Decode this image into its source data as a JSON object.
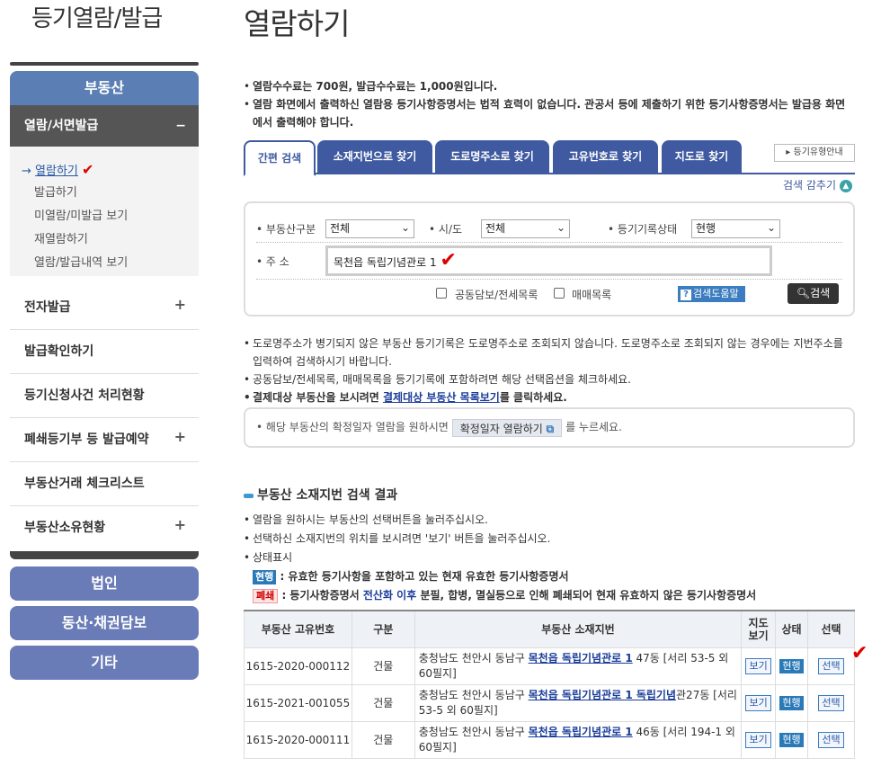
{
  "sidebar": {
    "title": "등기열람/발급",
    "category_main": "부동산",
    "open_section": {
      "label": "열람/서면발급",
      "toggle": "−"
    },
    "sub_items": [
      {
        "label": "열람하기",
        "active": true,
        "marker": "→",
        "check": "✔"
      },
      {
        "label": "발급하기"
      },
      {
        "label": "미열람/미발급 보기"
      },
      {
        "label": "재열람하기"
      },
      {
        "label": "열람/발급내역 보기"
      }
    ],
    "menu_items": [
      {
        "label": "전자발급",
        "toggle": "+"
      },
      {
        "label": "발급확인하기",
        "toggle": ""
      },
      {
        "label": "등기신청사건 처리현황",
        "toggle": ""
      },
      {
        "label": "폐쇄등기부 등 발급예약",
        "toggle": "+"
      },
      {
        "label": "부동산거래 체크리스트",
        "toggle": ""
      },
      {
        "label": "부동산소유현황",
        "toggle": "+"
      }
    ],
    "categories": [
      "법인",
      "동산·채권담보",
      "기타"
    ]
  },
  "main": {
    "title": "열람하기",
    "notice": [
      "열람수수료는 700원, 발급수수료는 1,000원입니다.",
      "열람 화면에서 출력하신 열람용 등기사항증명서는 법적 효력이 없습니다. 관공서 등에 제출하기 위한 등기사항증명서는 발급용 화면에서 출력해야 합니다."
    ],
    "tabs": [
      "간편 검색",
      "소재지번으로 찾기",
      "도로명주소로 찾기",
      "고유번호로 찾기",
      "지도로 찾기"
    ],
    "type_guide_label": "▸ 등기유형안내",
    "collapse_label": "검색 감추기",
    "search": {
      "property_type_label": "부동산구분",
      "property_type_value": "전체",
      "region_label": "시/도",
      "region_value": "전체",
      "record_status_label": "등기기록상태",
      "record_status_value": "현행",
      "address_label": "주 소",
      "address_value": "목천읍 독립기념관로 1",
      "option_joint": "공동담보/전세목록",
      "option_sale": "매매목록",
      "help_label": "검색도움말",
      "search_label": "검색"
    },
    "info": [
      "도로명주소가 병기되지 않은 부동산 등기기록은 도로명주소로 조회되지 않습니다. 도로명주소로 조회되지 않는 경우에는 지번주소를 입력하여 검색하시기 바랍니다.",
      "공동담보/전세목록, 매매목록을 등기기록에 포함하려면 해당 선택옵션을 체크하세요."
    ],
    "info_payment_prefix": "결제대상 부동산을 보시려면 ",
    "info_payment_link": "결제대상 부동산 목록보기",
    "info_payment_suffix": "를 클릭하세요.",
    "confirm_prefix": "해당 부동산의 확정일자 열람을 원하시면",
    "confirm_button": "확정일자 열람하기",
    "confirm_suffix": "를 누르세요.",
    "result_title": "부동산 소재지번 검색 결과",
    "result_info": [
      "열람을 원하시는 부동산의 선택버튼을 눌러주십시오.",
      "선택하신 소재지번의 위치를 보시려면 '보기' 버튼을 눌러주십시오.",
      "상태표시"
    ],
    "status_current_badge": "현행",
    "status_current_text": ": 유효한 등기사항을 포함하고 있는 현재 유효한 등기사항증명서",
    "status_closed_badge": "폐쇄",
    "status_closed_text_pre": ": 등기사항증명서 ",
    "status_closed_text_highlight": "전산화 이후",
    "status_closed_text_post": " 분필, 합병, 멸실등으로 인해 폐쇄되어 현재 유효하지 않은 등기사항증명서",
    "table": {
      "headers": [
        "부동산 고유번호",
        "구분",
        "부동산 소재지번",
        "지도\n보기",
        "상태",
        "선택"
      ],
      "rows": [
        {
          "id": "1615-2020-000112",
          "type": "건물",
          "addr_prefix": "충청남도 천안시 동남구 ",
          "addr_road": "목천읍 독립기념관로 1",
          "addr_suffix": " 47동 [서리 53-5 외 60필지]",
          "view": "보기",
          "status": "현행",
          "select": "선택"
        },
        {
          "id": "1615-2021-001055",
          "type": "건물",
          "addr_prefix": "충청남도 천안시 동남구 ",
          "addr_road": "목천읍 독립기념관로 1 독립기념",
          "addr_suffix": "관27동 [서리 53-5 외 60필지]",
          "view": "보기",
          "status": "현행",
          "select": "선택"
        },
        {
          "id": "1615-2020-000111",
          "type": "건물",
          "addr_prefix": "충청남도 천안시 동남구 ",
          "addr_road": "목천읍 독립기념관로 1",
          "addr_suffix": " 46동 [서리 194-1 외 60필지]",
          "view": "보기",
          "status": "현행",
          "select": "선택"
        }
      ]
    }
  }
}
